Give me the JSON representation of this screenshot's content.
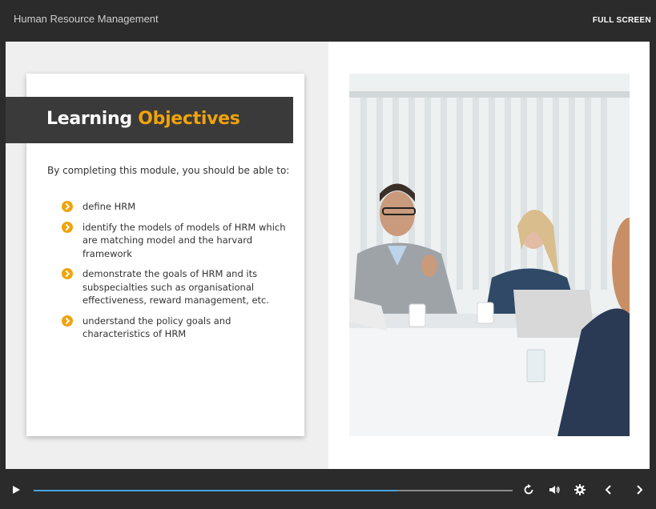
{
  "header": {
    "course_title": "Human Resource Management",
    "fullscreen_label": "FULL SCREEN"
  },
  "slide": {
    "heading_part1": "Learning",
    "heading_part2": "Objectives",
    "intro": "By completing this module, you should be able to:",
    "objectives": [
      "define HRM",
      "identify the models of models of HRM which are matching model and the harvard framework",
      "demonstrate the goals of HRM and its subspecialties such as organisational effectiveness, reward management, etc.",
      "understand the policy goals and characteristics of HRM"
    ]
  },
  "player": {
    "progress_fraction": 0.76
  },
  "colors": {
    "accent": "#f0a30a",
    "progress": "#4aa3df",
    "bar_bg": "#2b2b2b"
  },
  "icons": [
    "play-icon",
    "replay-icon",
    "volume-icon",
    "settings-icon",
    "prev-icon",
    "next-icon",
    "chevron-right-icon"
  ]
}
